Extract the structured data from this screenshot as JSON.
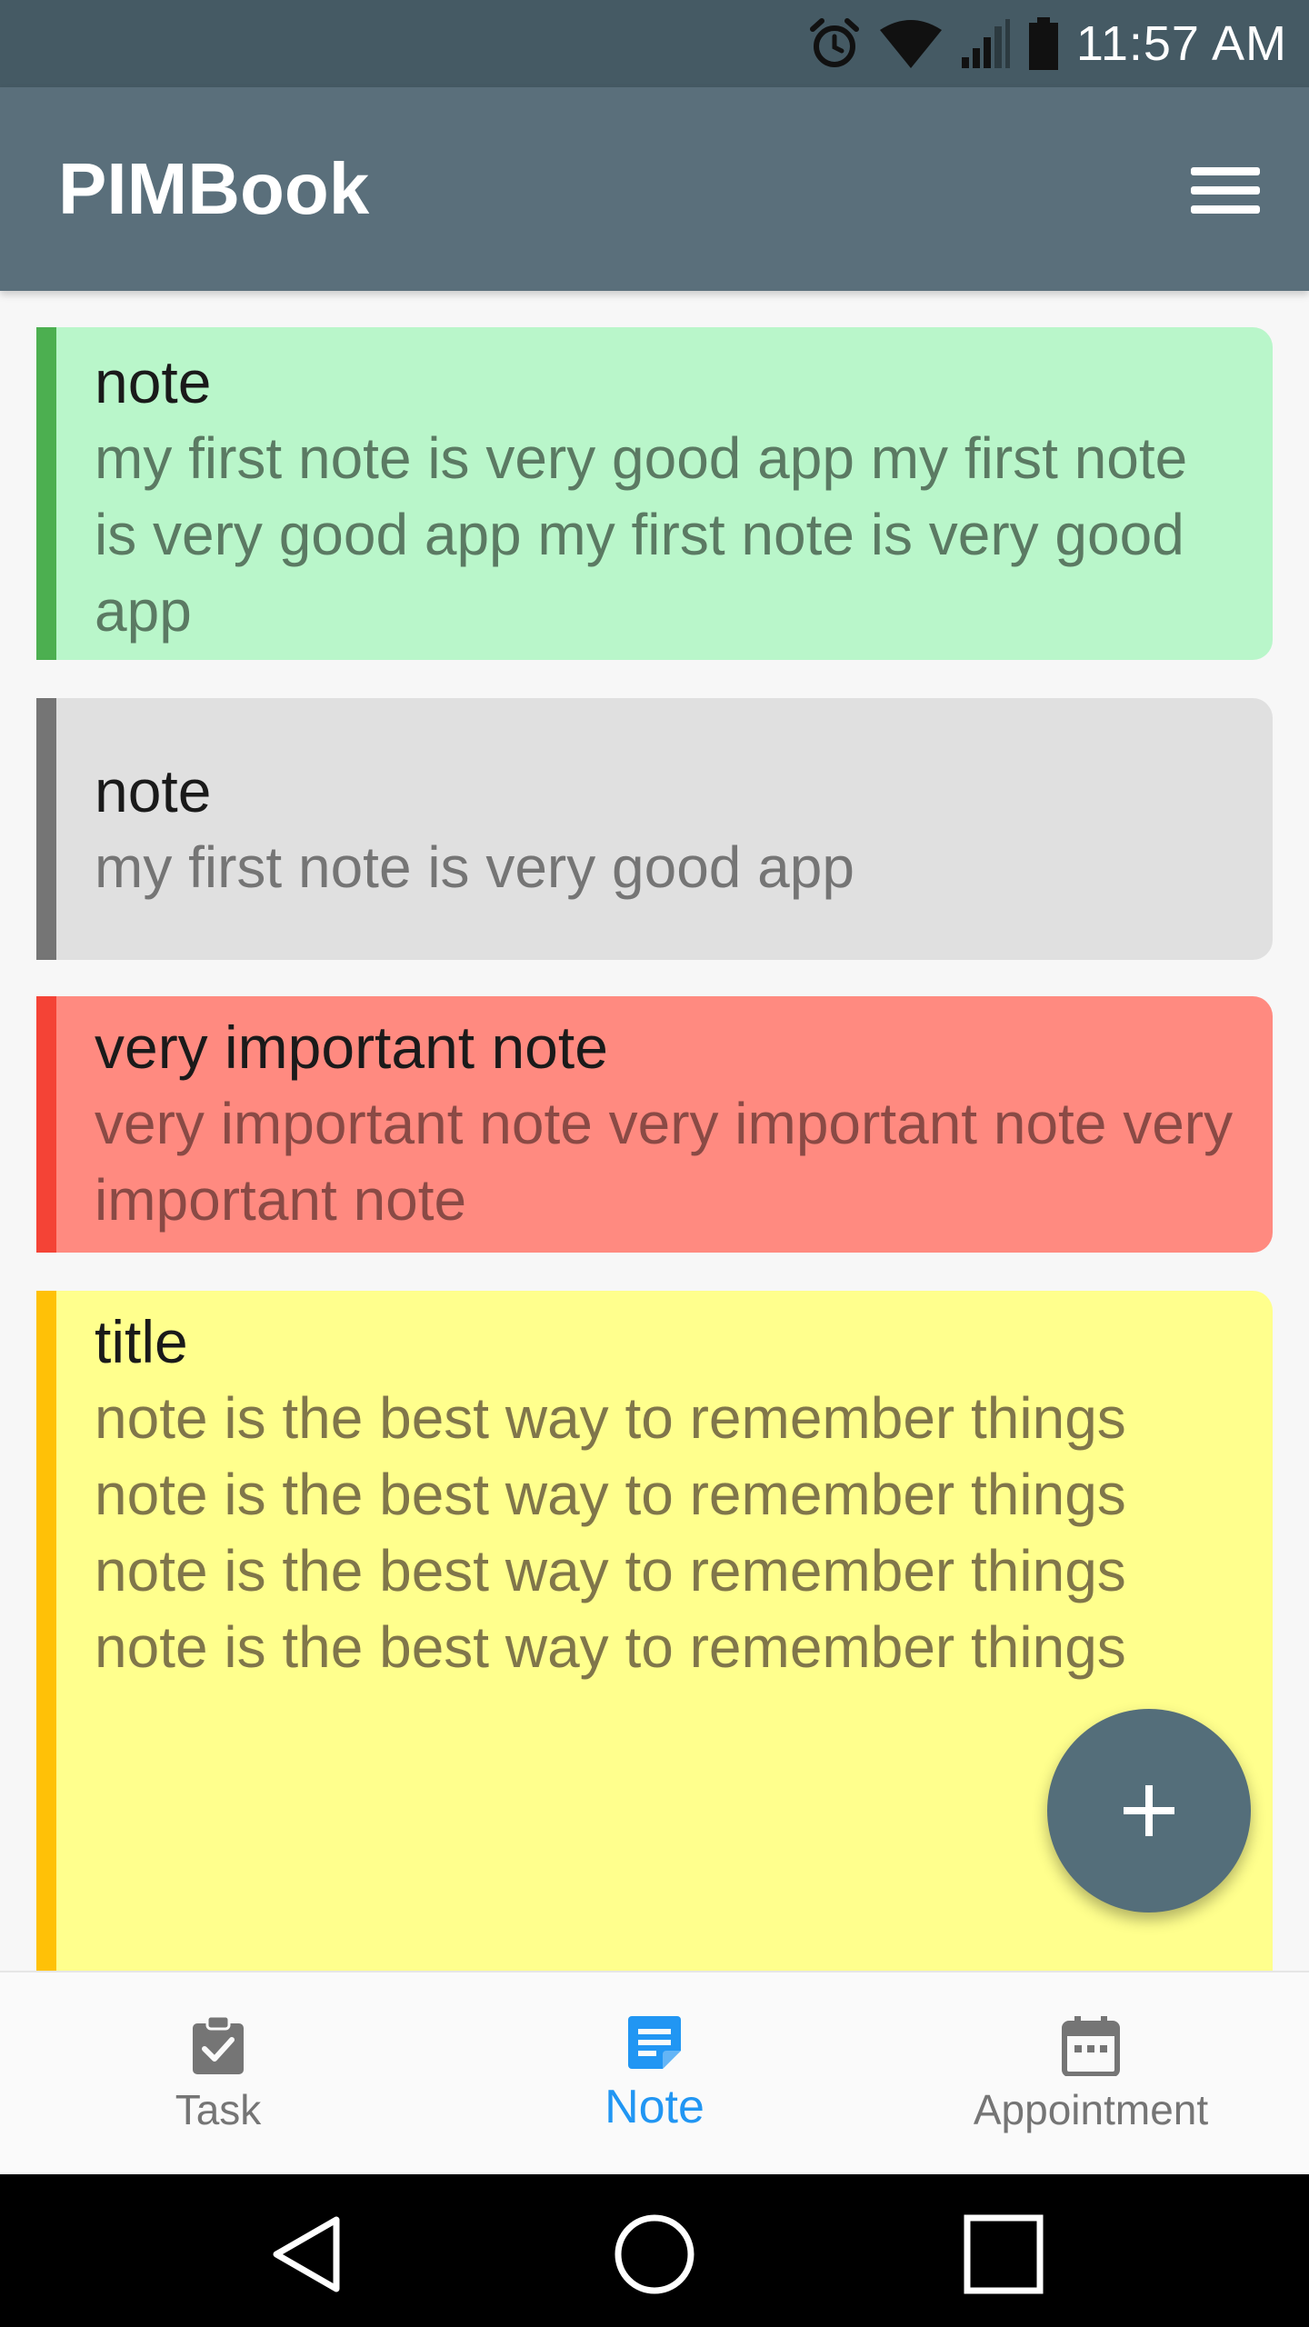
{
  "status_bar": {
    "time": "11:57 AM",
    "icons": [
      "alarm-icon",
      "wifi-icon",
      "signal-icon",
      "battery-icon"
    ]
  },
  "app_bar": {
    "title": "PIMBook",
    "menu_icon": "hamburger-menu-icon"
  },
  "notes": [
    {
      "title": "note",
      "body": "my first note is very good app my first note is very good app my first note is very good app",
      "accent": "#4caf50",
      "background": "#b9f6ca"
    },
    {
      "title": "note",
      "body": "my first note is very good app",
      "accent": "#757575",
      "background": "#e0e0e0"
    },
    {
      "title": "very important note",
      "body": "very important note very important note very important note",
      "accent": "#f44336",
      "background": "#ff8a80"
    },
    {
      "title": "title",
      "body": "note is the best way to remember things\nnote is the best way to remember things\nnote is the best way to remember things\nnote is the best way to remember things",
      "accent": "#ffc107",
      "background": "#ffff8d"
    }
  ],
  "fab": {
    "icon": "plus-icon",
    "color": "#546e7a"
  },
  "bottom_nav": {
    "items": [
      {
        "label": "Task",
        "icon": "clipboard-check-icon",
        "active": false
      },
      {
        "label": "Note",
        "icon": "note-icon",
        "active": true
      },
      {
        "label": "Appointment",
        "icon": "calendar-icon",
        "active": false
      }
    ],
    "active_color": "#2196f3"
  },
  "system_nav": {
    "icons": [
      "back-icon",
      "home-icon",
      "recents-icon"
    ]
  }
}
